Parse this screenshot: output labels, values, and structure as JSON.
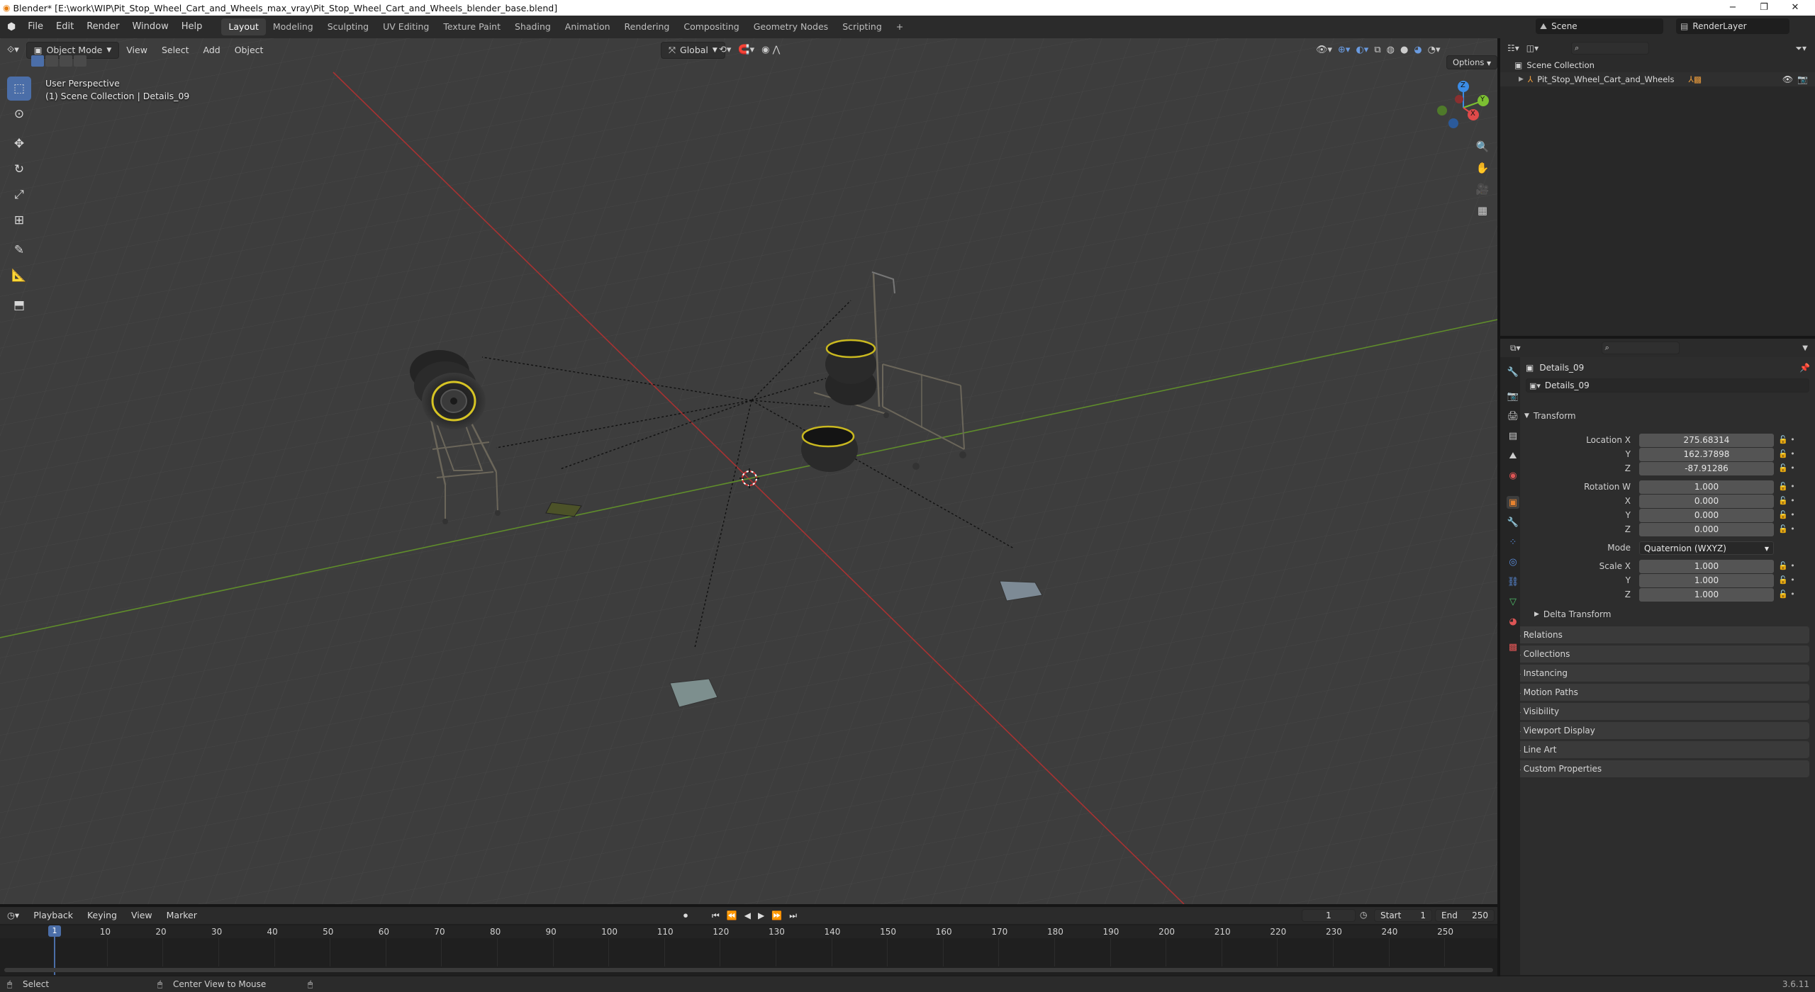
{
  "window": {
    "title": "Blender* [E:\\work\\WIP\\Pit_Stop_Wheel_Cart_and_Wheels_max_vray\\Pit_Stop_Wheel_Cart_and_Wheels_blender_base.blend]",
    "minimize": "−",
    "maximize": "❐",
    "close": "✕"
  },
  "menu": {
    "items": [
      "File",
      "Edit",
      "Render",
      "Window",
      "Help"
    ],
    "workspaces": [
      "Layout",
      "Modeling",
      "Sculpting",
      "UV Editing",
      "Texture Paint",
      "Shading",
      "Animation",
      "Rendering",
      "Compositing",
      "Geometry Nodes",
      "Scripting"
    ],
    "active_workspace": "Layout",
    "add_tab": "+",
    "scene": "Scene",
    "view_layer": "RenderLayer"
  },
  "viewport": {
    "mode": "Object Mode",
    "menus": [
      "View",
      "Select",
      "Add",
      "Object"
    ],
    "orientation": "Global",
    "options": "Options",
    "perspective_label": "User Perspective",
    "collection_label": "(1) Scene Collection | Details_09",
    "gizmo": {
      "x": "X",
      "y": "Y",
      "z": "Z"
    }
  },
  "outliner": {
    "root": "Scene Collection",
    "items": [
      "Pit_Stop_Wheel_Cart_and_Wheels"
    ]
  },
  "properties": {
    "object_name": "Details_09",
    "datablock_name": "Details_09",
    "transform_header": "Transform",
    "location_label": "Location X",
    "location": {
      "x": "275.68314",
      "y": "162.37898",
      "z": "-87.91286"
    },
    "rotation_label": "Rotation W",
    "rotation": {
      "w": "1.000",
      "x": "0.000",
      "y": "0.000",
      "z": "0.000"
    },
    "mode_label": "Mode",
    "mode_value": "Quaternion (WXYZ)",
    "scale_label": "Scale X",
    "scale": {
      "x": "1.000",
      "y": "1.000",
      "z": "1.000"
    },
    "axis_labels": {
      "x": "X",
      "y": "Y",
      "z": "Z"
    },
    "delta_transform": "Delta Transform",
    "panels": [
      "Relations",
      "Collections",
      "Instancing",
      "Motion Paths",
      "Visibility",
      "Viewport Display",
      "Line Art",
      "Custom Properties"
    ]
  },
  "timeline": {
    "menus": [
      "Playback",
      "Keying",
      "View",
      "Marker"
    ],
    "current_frame": "1",
    "start_label": "Start",
    "start": "1",
    "end_label": "End",
    "end": "250",
    "ticks": [
      "10",
      "20",
      "30",
      "40",
      "50",
      "60",
      "70",
      "80",
      "90",
      "100",
      "110",
      "120",
      "130",
      "140",
      "150",
      "160",
      "170",
      "180",
      "190",
      "200",
      "210",
      "220",
      "230",
      "240",
      "250"
    ],
    "playhead": "1"
  },
  "status": {
    "select": "Select",
    "center_view": "Center View to Mouse",
    "version": "3.6.11"
  },
  "colors": {
    "accent": "#4b6ea8",
    "x_axis": "#b03535",
    "y_axis": "#6a9a2a",
    "gizmo_x": "#e04a4a",
    "gizmo_y": "#7cbf32",
    "gizmo_z": "#3b8ce6"
  }
}
